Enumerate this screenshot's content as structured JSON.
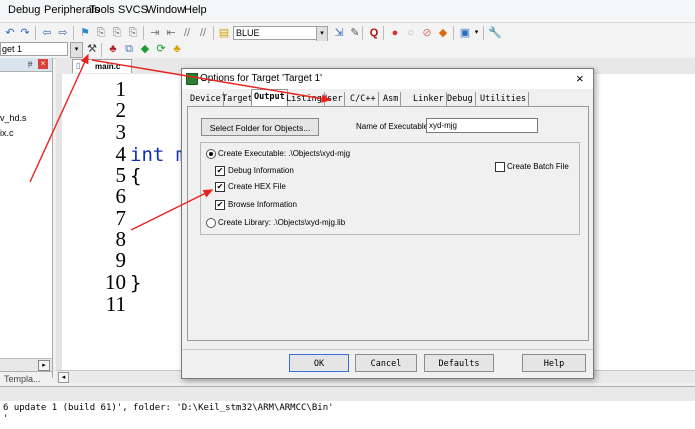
{
  "menu": [
    "Debug",
    "Peripherals",
    "Tools",
    "SVCS",
    "Window",
    "Help"
  ],
  "toolbar": {
    "target_combo": "BLUE",
    "target_select": "get 1"
  },
  "left_panel": {
    "files": [
      "v_hd.s",
      "ix.c"
    ],
    "bottom_tab": "Templa..."
  },
  "editor": {
    "tab_label": "main.c",
    "line_numbers": [
      "1",
      "2",
      "3",
      "4",
      "5",
      "6",
      "7",
      "8",
      "9",
      "10",
      "11"
    ],
    "code": {
      "line4": "int m",
      "line5": "{",
      "line10": "}"
    }
  },
  "dialog": {
    "title": "Options for Target 'Target 1'",
    "close": "×",
    "tabs": [
      "Device",
      "Target",
      "Output",
      "Listing",
      "User",
      "C/C++",
      "Asm",
      "Linker",
      "Debug",
      "Utilities"
    ],
    "select_folder_button": "Select Folder for Objects...",
    "name_of_executable_label": "Name of Executable:",
    "name_of_executable_value": "xyd-mjg",
    "create_executable_label": "Create Executable:  .\\Objects\\xyd-mjg",
    "debug_information": "Debug Information",
    "create_hex_file": "Create HEX File",
    "browse_information": "Browse Information",
    "create_batch_file": "Create Batch File",
    "create_library_label": "Create Library:  .\\Objects\\xyd-mjg.lib",
    "ok": "OK",
    "cancel": "Cancel",
    "defaults": "Defaults",
    "help": "Help"
  },
  "output": {
    "line1": "6 update 1 (build 61)', folder: 'D:\\Keil_stm32\\ARM\\ARMCC\\Bin'",
    "line2": "'"
  },
  "colors": {
    "arrow": "#e8231f",
    "accent": "#d9e3ee"
  }
}
